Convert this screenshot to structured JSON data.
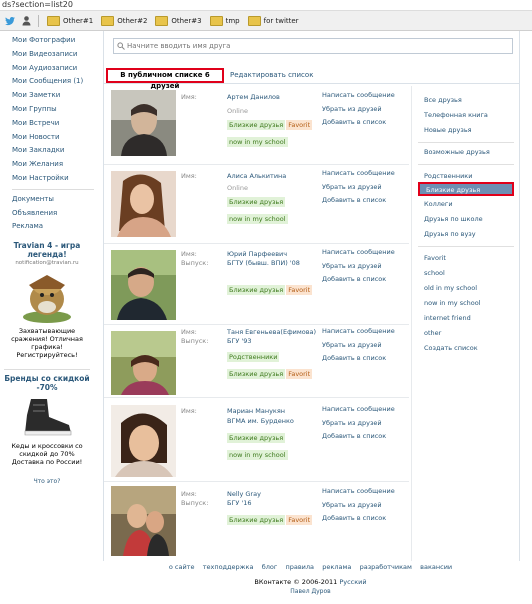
{
  "browser": {
    "address": "ds?section=list20",
    "bookmarks": [
      "Other#1",
      "Other#2",
      "Other#3",
      "tmp",
      "for twitter"
    ]
  },
  "leftnav": {
    "items": [
      "Мои Фотографии",
      "Мои Видеозаписи",
      "Мои Аудиозаписи",
      "Мои Сообщения (1)",
      "Мои Заметки",
      "Мои Группы",
      "Мои Встречи",
      "Мои Новости",
      "Мои Закладки",
      "Мои Желания",
      "Мои Настройки"
    ],
    "items2": [
      "Документы",
      "Объявления",
      "Реклама"
    ]
  },
  "ads": [
    {
      "title": "Travian 4 - игра легенда!",
      "site": "notification@travian.ru",
      "desc": "Захватывающие сражения! Отличная графика! Регистрируйтесь!"
    },
    {
      "title": "Бренды со скидкой -70%",
      "site": "",
      "desc": "Кеды и кроссовки со скидкой до 70% Доставка по России!"
    }
  ],
  "ads_more": "Что это?",
  "search": {
    "placeholder": "Начните вводить имя друга"
  },
  "tabs": {
    "active": "В публичном списке 6 друзей",
    "edit": "Редактировать список"
  },
  "labels": {
    "name": "Имя:",
    "grad": "Выпуск:"
  },
  "actions": [
    "Написать сообщение",
    "Убрать из друзей",
    "Добавить в список"
  ],
  "friends": [
    {
      "name": "Артем Данилов",
      "status": "Online",
      "grad": "",
      "tags": [
        [
          "Близкие друзья",
          "Favorit"
        ],
        [
          "now in my school"
        ]
      ]
    },
    {
      "name": "Алиса Алькитина",
      "status": "Online",
      "grad": "",
      "tags": [
        [
          "Близкие друзья"
        ],
        [
          "now in my school"
        ]
      ]
    },
    {
      "name": "Юрий Парфеевич",
      "status": "",
      "grad": "БГТУ (бывш. ВПИ) '08",
      "tags": [
        [
          "Близкие друзья",
          "Favorit"
        ]
      ]
    },
    {
      "name": "Таня Евгеньева(Ефимова)",
      "status": "",
      "grad": "БГУ '93",
      "tags": [
        [
          "Родственники"
        ],
        [
          "Близкие друзья",
          "Favorit"
        ]
      ]
    },
    {
      "name": "Мариан Манукян",
      "status": "",
      "grad": "ВГМА им. Бурденко",
      "tags": [
        [
          "Близкие друзья"
        ],
        [
          "now in my school"
        ]
      ]
    },
    {
      "name": "Nelly Gray",
      "status": "",
      "grad": "БГУ '16",
      "tags": [
        [
          "Близкие друзья",
          "Favorit"
        ]
      ]
    }
  ],
  "sidebar": {
    "top": [
      "Все друзья",
      "Телефонная книга",
      "Новые друзья"
    ],
    "possible": "Возможные друзья",
    "relatives": "Родственники",
    "close": "Близкие друзья",
    "lists": [
      "Коллеги",
      "Друзья по школе",
      "Друзья по вузу"
    ],
    "custom": [
      "Favorit",
      "school",
      "old in my school",
      "now in my school",
      "internet friend",
      "other"
    ],
    "create": "Создать список"
  },
  "footer": {
    "links": [
      "о сайте",
      "техподдержка",
      "блог",
      "правила",
      "реклама",
      "разработчикам",
      "вакансии"
    ],
    "copyright": "ВКонтакте © 2006-2011",
    "language": "Русский",
    "author": "Павел Дуров"
  },
  "colors": {
    "link": "#2b587a",
    "highlight": "#6d8fb3",
    "annotation": "#e0001a",
    "tag_bg": "#e1f2d8",
    "fav_bg": "#fbe3cf"
  }
}
